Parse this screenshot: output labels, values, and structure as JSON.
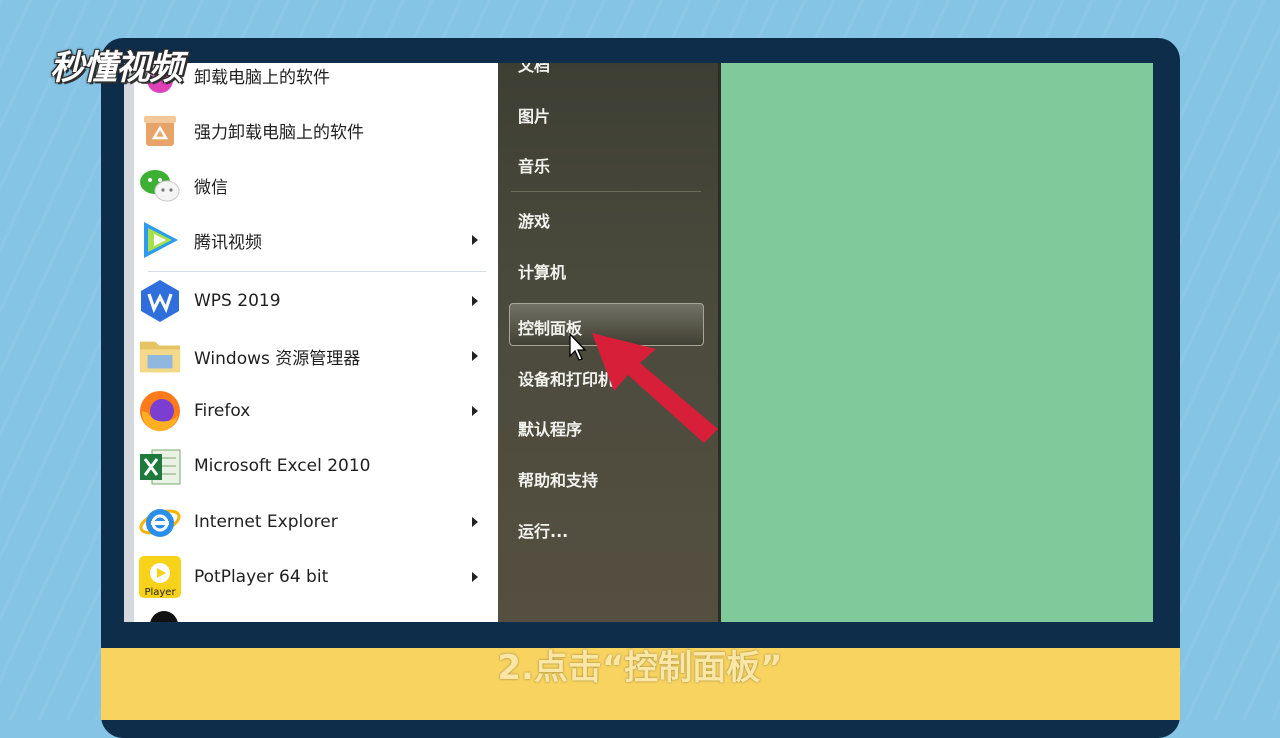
{
  "brand": {
    "logo_text": "秒懂视频"
  },
  "start_menu": {
    "programs": [
      {
        "label": "卸载电脑上的软件",
        "icon": "uninstall-bubble-icon",
        "has_submenu": false
      },
      {
        "label": "强力卸载电脑上的软件",
        "icon": "recycle-box-icon",
        "has_submenu": false
      },
      {
        "label": "微信",
        "icon": "wechat-icon",
        "has_submenu": false
      },
      {
        "label": "腾讯视频",
        "icon": "tencent-video-icon",
        "has_submenu": true
      },
      {
        "label": "WPS 2019",
        "icon": "wps-icon",
        "has_submenu": true
      },
      {
        "label": "Windows 资源管理器",
        "icon": "folder-icon",
        "has_submenu": true
      },
      {
        "label": "Firefox",
        "icon": "firefox-icon",
        "has_submenu": true
      },
      {
        "label": "Microsoft Excel 2010",
        "icon": "excel-icon",
        "has_submenu": false
      },
      {
        "label": "Internet Explorer",
        "icon": "ie-icon",
        "has_submenu": true
      },
      {
        "label": "PotPlayer 64 bit",
        "icon": "potplayer-icon",
        "has_submenu": true
      }
    ],
    "potplayer_icon_text": "Player",
    "places": [
      "文档",
      "图片",
      "音乐",
      "游戏",
      "计算机",
      "控制面板",
      "设备和打印机",
      "默认程序",
      "帮助和支持",
      "运行..."
    ],
    "highlighted": "控制面板"
  },
  "caption": "2.点击“控制面板”",
  "colors": {
    "background": "#86c4e6",
    "monitor_frame": "#0e2d4b",
    "desktop": "#80c99b",
    "caption_bar": "#f8d35f",
    "arrow": "#d81f3a"
  }
}
